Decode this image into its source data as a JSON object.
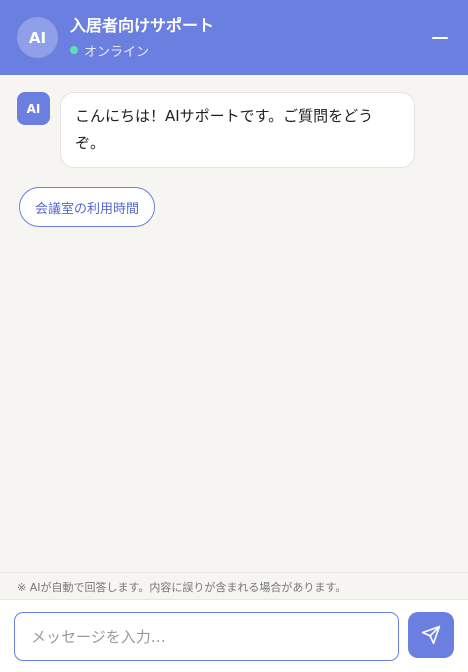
{
  "header": {
    "avatar_text": "AI",
    "title": "入居者向けサポート",
    "status": "オンライン"
  },
  "chat": {
    "bot_avatar": "AI",
    "messages": [
      {
        "from": "bot",
        "text": "こんにちは！AIサポートです。ご質問をどうぞ。"
      }
    ],
    "quick_replies": [
      "会議室の利用時間"
    ]
  },
  "disclaimer": "※ AIが自動で回答します。内容に誤りが含まれる場合があります。",
  "composer": {
    "placeholder": "メッセージを入力…",
    "value": ""
  },
  "icons": {
    "minimize": "minimize-icon",
    "send": "send-icon",
    "status": "online-dot-icon"
  },
  "colors": {
    "accent": "#6a7fe0",
    "online": "#5ee0b0"
  }
}
